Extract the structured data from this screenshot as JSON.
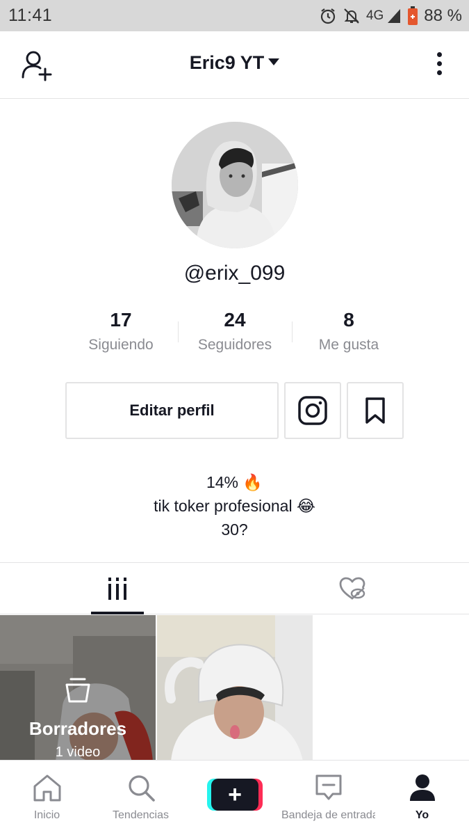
{
  "status_bar": {
    "time": "11:41",
    "network": "4G",
    "battery": "88 %",
    "icons": [
      "alarm-icon",
      "notifications-off-icon",
      "signal-icon",
      "battery-icon"
    ]
  },
  "header": {
    "account_name": "Eric9 YT",
    "icons": [
      "add-user-icon",
      "caret-down-icon",
      "more-vertical-icon"
    ]
  },
  "profile": {
    "username": "@erix_099",
    "stats": [
      {
        "value": "17",
        "label": "Siguiendo"
      },
      {
        "value": "24",
        "label": "Seguidores"
      },
      {
        "value": "8",
        "label": "Me gusta"
      }
    ],
    "edit_button": "Editar perfil",
    "bio_lines": [
      "14% 🔥",
      "tik toker profesional 😂",
      "30?"
    ]
  },
  "tabs": {
    "active": "videos",
    "icons": [
      "videos-grid-icon",
      "liked-hidden-icon"
    ]
  },
  "grid": {
    "drafts_title": "Borradores",
    "drafts_count": "1 video"
  },
  "bottom_nav": {
    "items": [
      {
        "label": "Inicio",
        "icon": "home-icon"
      },
      {
        "label": "Tendencias",
        "icon": "search-icon"
      },
      {
        "label": "",
        "icon": "plus-icon"
      },
      {
        "label": "Bandeja de entrada",
        "icon": "inbox-icon"
      },
      {
        "label": "Yo",
        "icon": "profile-icon"
      }
    ],
    "active": "Yo"
  },
  "colors": {
    "text": "#161823",
    "muted": "#8a8b91",
    "border": "#e3e3e4",
    "cyan": "#25f4ee",
    "pink": "#fe2c55"
  }
}
